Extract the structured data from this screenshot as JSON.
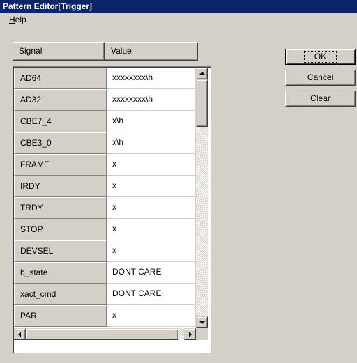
{
  "window": {
    "title": "Pattern Editor[Trigger]"
  },
  "menu": {
    "help_hotkey": "H",
    "help_rest": "elp"
  },
  "grid": {
    "columns": {
      "signal": "Signal",
      "value": "Value"
    },
    "rows": [
      {
        "signal": "AD64",
        "value": "xxxxxxxx\\h"
      },
      {
        "signal": "AD32",
        "value": "xxxxxxxx\\h"
      },
      {
        "signal": "CBE7_4",
        "value": "x\\h"
      },
      {
        "signal": "CBE3_0",
        "value": "x\\h"
      },
      {
        "signal": "FRAME",
        "value": "x"
      },
      {
        "signal": "IRDY",
        "value": "x"
      },
      {
        "signal": "TRDY",
        "value": "x"
      },
      {
        "signal": "STOP",
        "value": "x"
      },
      {
        "signal": "DEVSEL",
        "value": "x"
      },
      {
        "signal": "b_state",
        "value": "DONT CARE"
      },
      {
        "signal": "xact_cmd",
        "value": "DONT CARE"
      },
      {
        "signal": "PAR",
        "value": "x"
      }
    ]
  },
  "buttons": {
    "ok": "OK",
    "cancel": "Cancel",
    "clear": "Clear"
  },
  "colors": {
    "titlebar": "#0a246a",
    "face": "#d4d0c8"
  }
}
